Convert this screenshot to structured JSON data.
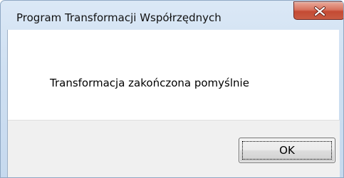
{
  "window": {
    "title": "Program Transformacji Współrzędnych"
  },
  "dialog": {
    "message": "Transformacja zakończona pomyślnie",
    "ok_label": "OK"
  },
  "icons": {
    "close": "close-icon"
  },
  "colors": {
    "titlebar": "#cfe0f2",
    "close_button": "#c44a33",
    "footer": "#f0f0f0"
  }
}
